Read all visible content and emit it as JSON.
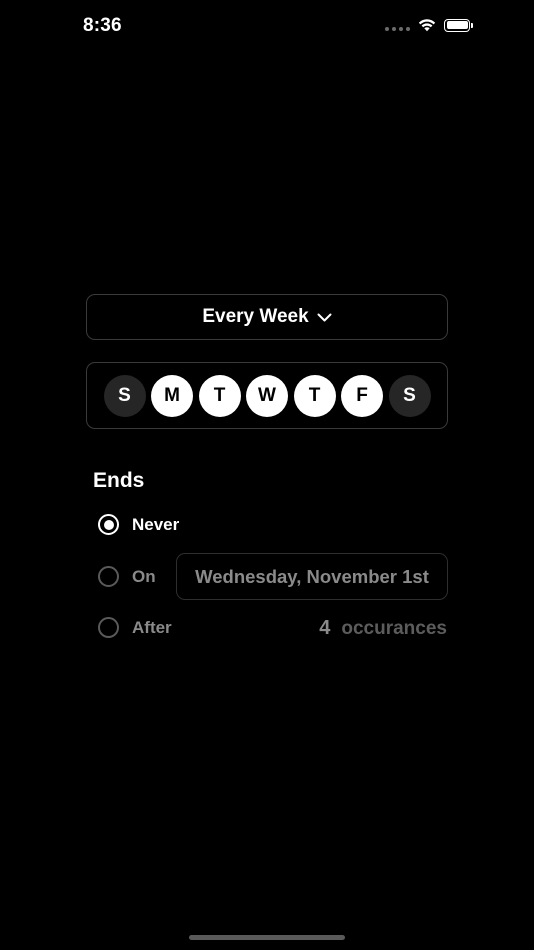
{
  "status_bar": {
    "time": "8:36"
  },
  "frequency": {
    "label": "Every Week",
    "icon": "chevron-down-icon"
  },
  "weekdays": [
    {
      "letter": "S",
      "selected": false
    },
    {
      "letter": "M",
      "selected": true
    },
    {
      "letter": "T",
      "selected": true
    },
    {
      "letter": "W",
      "selected": true
    },
    {
      "letter": "T",
      "selected": true
    },
    {
      "letter": "F",
      "selected": true
    },
    {
      "letter": "S",
      "selected": false
    }
  ],
  "ends": {
    "heading": "Ends",
    "options": [
      {
        "label": "Never",
        "selected": true
      },
      {
        "label": "On",
        "selected": false
      },
      {
        "label": "After",
        "selected": false
      }
    ],
    "on_date": "Wednesday, November 1st",
    "after_count": "4",
    "after_unit": "occurances"
  },
  "colors": {
    "background": "#000000",
    "text": "#ffffff",
    "muted": "#8a8a8a",
    "border": "#3a3a3a"
  }
}
